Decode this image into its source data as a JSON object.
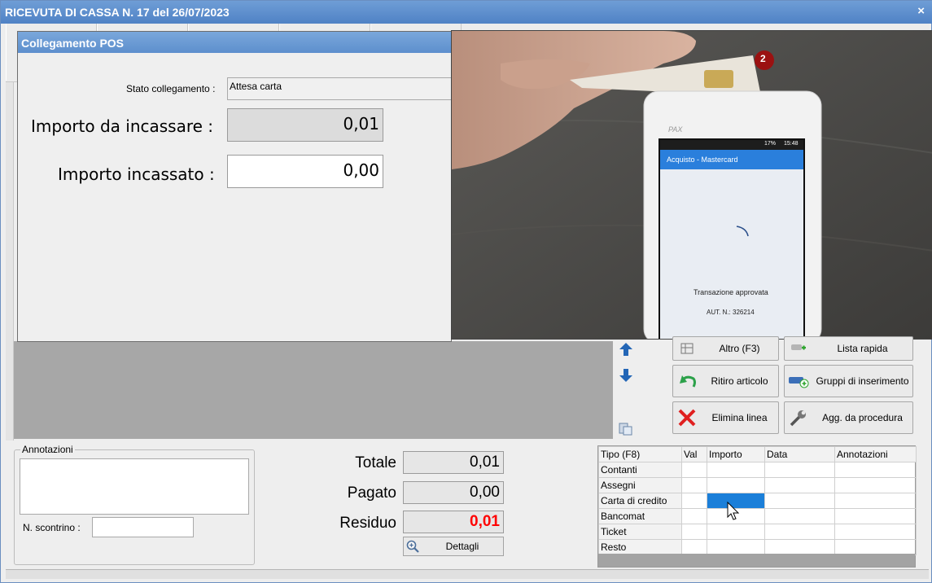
{
  "window": {
    "title": "RICEVUTA DI CASSA N. 17 del 26/07/2023",
    "close_glyph": "×"
  },
  "pos_dialog": {
    "title": "Collegamento POS",
    "stato_label": "Stato collegamento :",
    "stato_value": "Attesa carta",
    "importo_da_incassare_label": "Importo da incassare :",
    "importo_da_incassare_value": "0,01",
    "importo_incassato_label": "Importo incassato :",
    "importo_incassato_value": "0,00"
  },
  "photo": {
    "badge": "2",
    "terminal_brand": "PAX",
    "terminal_status_time": "15:48",
    "terminal_battery": "17%",
    "terminal_app_bar": "Acquisto - Mastercard",
    "terminal_message": "Transazione approvata",
    "terminal_auth": "AUT. N.: 326214"
  },
  "actions": {
    "altro": "Altro (F3)",
    "lista_rapida": "Lista rapida",
    "ritiro_articolo": "Ritiro articolo",
    "gruppi_inserimento": "Gruppi di inserimento",
    "elimina_linea": "Elimina linea",
    "agg_procedura": "Agg. da procedura"
  },
  "annotazioni": {
    "legend": "Annotazioni",
    "scontrino_label": "N. scontrino :"
  },
  "totals": {
    "totale_label": "Totale",
    "totale_value": "0,01",
    "pagato_label": "Pagato",
    "pagato_value": "0,00",
    "residuo_label": "Residuo",
    "residuo_value": "0,01",
    "residuo_color": "#ff0000",
    "dettagli_label": "Dettagli"
  },
  "payments": {
    "headers": [
      "Tipo (F8)",
      "Val",
      "Importo",
      "Data",
      "Annotazioni"
    ],
    "rows": [
      "Contanti",
      "Assegni",
      "Carta di credito",
      "Bancomat",
      "Ticket",
      "Resto"
    ],
    "selected_row": "Carta di credito",
    "selected_color": "#1b7fd9"
  }
}
